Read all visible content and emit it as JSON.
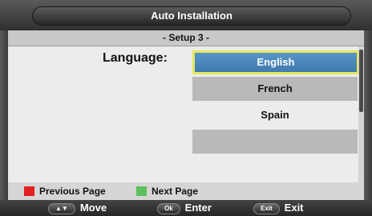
{
  "title": "Auto Installation",
  "subtitle": "- Setup 3 -",
  "language_label": "Language:",
  "languages": [
    "English",
    "French",
    "Spain",
    ""
  ],
  "selected_index": 0,
  "legend": {
    "previous_label": "Previous Page",
    "previous_color": "#e02020",
    "next_label": "Next Page",
    "next_color": "#5cc05c"
  },
  "hints": {
    "move_key": "▲▼",
    "move_label": "Move",
    "enter_key": "Ok",
    "enter_label": "Enter",
    "exit_key": "Exit",
    "exit_label": "Exit"
  },
  "colors": {
    "selected_bg": "#4a86bc",
    "selected_border": "#e4e85a"
  }
}
